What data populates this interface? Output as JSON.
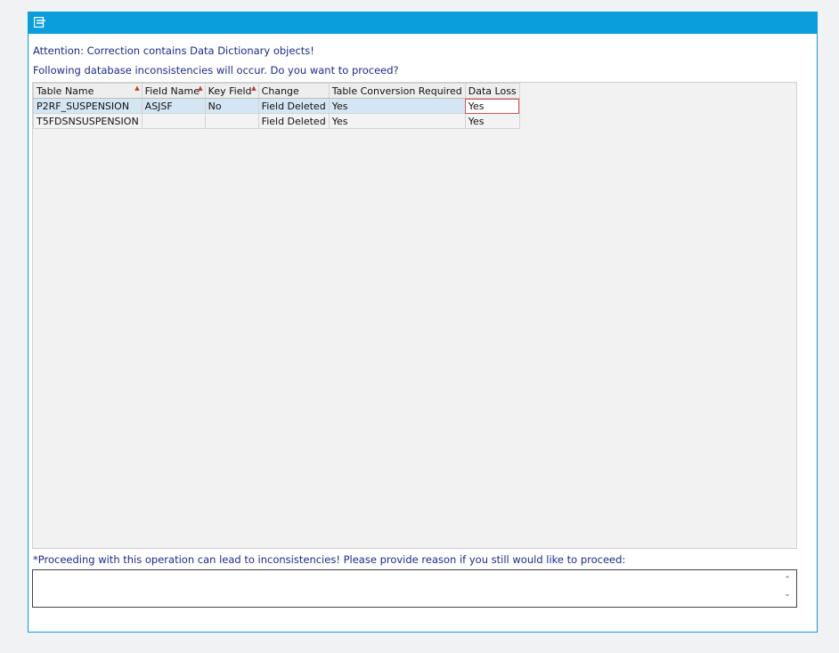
{
  "dialog": {
    "attention": "Attention: Correction contains Data Dictionary objects!",
    "question": "Following database inconsistencies will occur. Do you want to proceed?",
    "warning": "*Proceeding with this operation can lead to inconsistencies! Please provide reason if you still would like to proceed:",
    "reason_value": ""
  },
  "table": {
    "headers": [
      "Table Name",
      "Field Name",
      "Key Field",
      "Change",
      "Table Conversion Required",
      "Data Loss"
    ],
    "rows": [
      [
        "P2RF_SUSPENSION",
        "ASJSF",
        "No",
        "Field Deleted",
        "Yes",
        "Yes"
      ],
      [
        "T5FDSNSUSPENSION",
        "",
        "",
        "Field Deleted",
        "Yes",
        "Yes"
      ]
    ]
  },
  "icons": {
    "menu": "menu-icon",
    "sort": "sort-indicator-icon",
    "scroll_up": "chevron-up-icon",
    "scroll_down": "chevron-down-icon"
  },
  "colors": {
    "titlebar": "#0a9fdc",
    "text": "#1d2a8a",
    "selected_row": "#d4e6f4"
  }
}
